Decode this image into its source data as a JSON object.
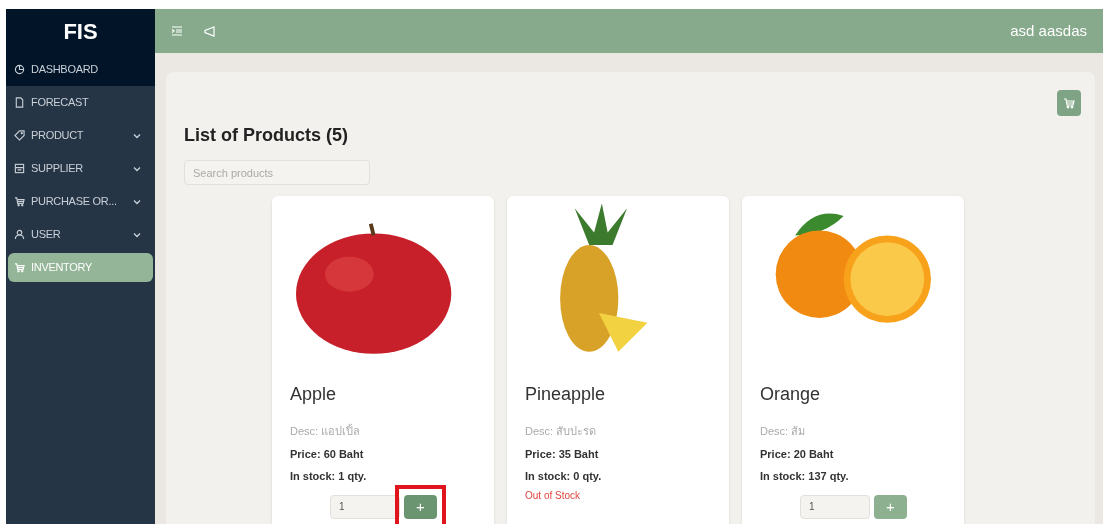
{
  "sidebar": {
    "logo": "FIS",
    "items": [
      {
        "label": "DASHBOARD",
        "submenu": false,
        "selected": false
      },
      {
        "label": "FORECAST",
        "submenu": false,
        "selected": false
      },
      {
        "label": "PRODUCT",
        "submenu": true,
        "selected": false
      },
      {
        "label": "SUPPLIER",
        "submenu": true,
        "selected": false
      },
      {
        "label": "PURCHASE OR...",
        "submenu": true,
        "selected": false
      },
      {
        "label": "USER",
        "submenu": true,
        "selected": false
      },
      {
        "label": "INVENTORY",
        "submenu": false,
        "selected": true
      }
    ]
  },
  "header": {
    "user": "asd aasdas"
  },
  "page": {
    "title": "List of Products (5)",
    "search": {
      "placeholder": "Search products"
    }
  },
  "products": [
    {
      "name": "Apple",
      "desc": "Desc: แอปเปิ้ล",
      "price": "Price: 60 Baht",
      "stock": "In stock: 1 qty.",
      "quantity": "1",
      "add_button": "+",
      "highlighted": true
    },
    {
      "name": "Pineapple",
      "desc": "Desc: สับปะรด",
      "price": "Price: 35 Baht",
      "stock": "In stock: 0 qty.",
      "out_of_stock": "Out of Stock",
      "highlighted": false
    },
    {
      "name": "Orange",
      "desc": "Desc: ส้ม",
      "price": "Price: 20 Baht",
      "stock": "In stock: 137 qty.",
      "quantity": "1",
      "add_button": "+",
      "highlighted": false
    }
  ]
}
